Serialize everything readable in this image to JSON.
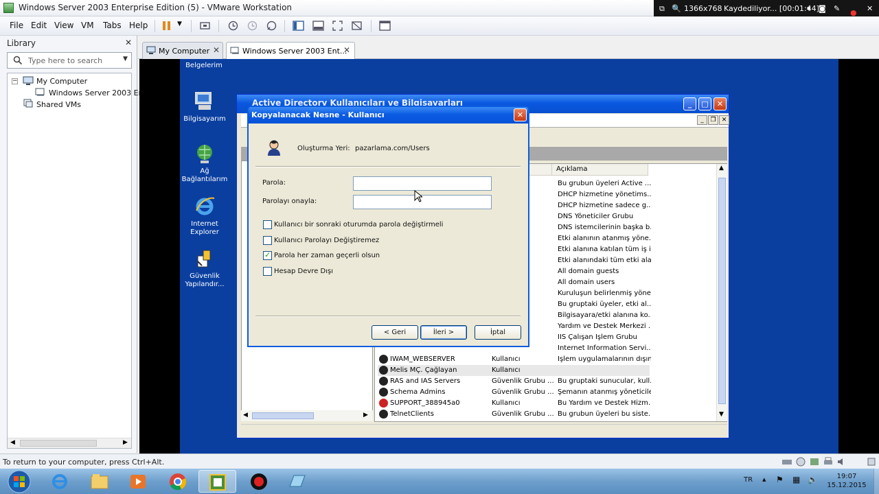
{
  "window": {
    "title": "Windows Server 2003 Enterprise Edition (5) - VMware Workstation"
  },
  "recorder": {
    "resolution": "1366x768",
    "status": "Kaydediliyor... [00:01:44]"
  },
  "menu": [
    "File",
    "Edit",
    "View",
    "VM",
    "Tabs",
    "Help"
  ],
  "library": {
    "title": "Library",
    "search_placeholder": "Type here to search",
    "tree": {
      "my_computer": "My Computer",
      "vm": "Windows Server 2003 Ent",
      "shared": "Shared VMs"
    }
  },
  "tabs": [
    {
      "label": "My Computer",
      "active": false
    },
    {
      "label": "Windows Server 2003 Ent...",
      "active": true
    }
  ],
  "guest_desktop": {
    "icons": [
      {
        "name": "belgelerim",
        "label": "Belgelerim"
      },
      {
        "name": "bilgisayarim",
        "label": "Bilgisayarım"
      },
      {
        "name": "ag",
        "label": "Ağ Bağlantılarım"
      },
      {
        "name": "ie",
        "label": "Internet Explorer"
      },
      {
        "name": "guvenlik",
        "label": "Güvenlik Yapılandır..."
      }
    ]
  },
  "ad_window": {
    "title": "Active Directory Kullanıcıları ve Bilgisayarları",
    "column_description": "Açıklama",
    "rows": [
      {
        "name": "",
        "type": "",
        "desc": "Bu grubun üyeleri Active ..."
      },
      {
        "name": "",
        "type": "",
        "desc": "DHCP hizmetine yönetims..."
      },
      {
        "name": "",
        "type": "",
        "desc": "DHCP hizmetine sadece g..."
      },
      {
        "name": "",
        "type": "",
        "desc": "DNS Yöneticiler Grubu"
      },
      {
        "name": "",
        "type": "",
        "desc": "DNS istemcilerinin başka b..."
      },
      {
        "name": "",
        "type": "",
        "desc": "Etki alanının atanmış yöne..."
      },
      {
        "name": "",
        "type": "",
        "desc": "Etki alanına katılan tüm iş i..."
      },
      {
        "name": "",
        "type": "",
        "desc": "Etki alanındaki tüm etki ala..."
      },
      {
        "name": "",
        "type": "",
        "desc": "All domain guests"
      },
      {
        "name": "",
        "type": "",
        "desc": "All domain users"
      },
      {
        "name": "",
        "type": "",
        "desc": "Kuruluşun belirlenmiş yöne..."
      },
      {
        "name": "",
        "type": "",
        "desc": "Bu gruptaki üyeler, etki al..."
      },
      {
        "name": "",
        "type": "",
        "desc": "Bilgisayara/etki alanına ko..."
      },
      {
        "name": "",
        "type": "",
        "desc": "Yardım ve Destek Merkezi ..."
      },
      {
        "name": "",
        "type": "",
        "desc": "IIS Çalışan İşlem Grubu"
      },
      {
        "name": "",
        "type": "",
        "desc": "Internet Information Servi..."
      },
      {
        "name": "IWAM_WEBSERVER",
        "type": "Kullanıcı",
        "desc": "İşlem uygulamalarının dışın..."
      },
      {
        "name": "Melis MÇ. Çağlayan",
        "type": "Kullanıcı",
        "desc": ""
      },
      {
        "name": "RAS and IAS Servers",
        "type": "Güvenlik Grubu ...",
        "desc": "Bu gruptaki sunucular, kull..."
      },
      {
        "name": "Schema Admins",
        "type": "Güvenlik Grubu ...",
        "desc": "Şemanın atanmış yöneticileri"
      },
      {
        "name": "SUPPORT_388945a0",
        "type": "Kullanıcı",
        "desc": "Bu Yardım ve Destek Hizm..."
      },
      {
        "name": "TelnetClients",
        "type": "Güvenlik Grubu ...",
        "desc": "Bu grubun üyeleri bu siste..."
      }
    ]
  },
  "dialog": {
    "title": "Kopyalanacak Nesne - Kullanıcı",
    "create_in_label": "Oluşturma Yeri:",
    "create_in_value": "pazarlama.com/Users",
    "password_label": "Parola:",
    "confirm_label": "Parolayı onayla:",
    "password_value": "",
    "confirm_value": "",
    "checkboxes": [
      {
        "label": "Kullanıcı bir sonraki oturumda parola değiştirmeli",
        "checked": false
      },
      {
        "label": "Kullanıcı Parolayı Değiştiremez",
        "checked": false
      },
      {
        "label": "Parola her zaman geçerli olsun",
        "checked": true
      },
      {
        "label": "Hesap Devre Dışı",
        "checked": false
      }
    ],
    "buttons": {
      "back": "< Geri",
      "next": "İleri >",
      "cancel": "İptal"
    }
  },
  "statusbar": {
    "text": "To return to your computer, press Ctrl+Alt."
  },
  "taskbar": {
    "lang": "TR",
    "time": "19:07",
    "date": "15.12.2015"
  }
}
